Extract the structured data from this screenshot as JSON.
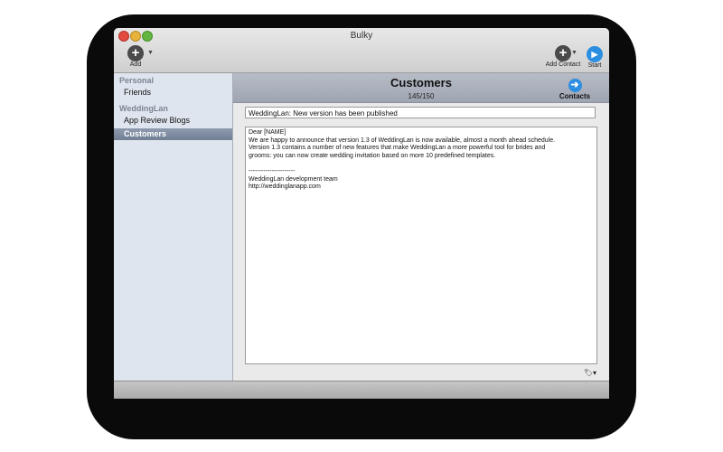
{
  "window": {
    "title": "Bulky"
  },
  "toolbar": {
    "add_icon": "plus-icon",
    "add_label": "Add",
    "add_contact_label": "Add Contact",
    "start_icon": "play-icon",
    "start_label": "Start"
  },
  "sidebar": {
    "groups": [
      {
        "header": "Personal",
        "items": [
          "Friends"
        ]
      },
      {
        "header": "WeddingLan",
        "items": [
          "App Review Blogs",
          "Customers"
        ]
      }
    ],
    "selected": "Customers"
  },
  "main": {
    "title": "Customers",
    "count": "145/150",
    "contacts_label": "Contacts",
    "subject": "WeddingLan: New version has been published",
    "body_lines": [
      "Dear [NAME]",
      "We are happy to announce that version 1.3 of WeddingLan is now available, almost a month ahead schedule.",
      "Version 1.3  contains a number of new features that make WeddingLan a more powerful tool for brides and",
      "grooms: you can now create wedding invitation based on more 10 predefined templates.",
      "",
      "----------------------",
      "WeddingLan development team",
      "http://weddinglanapp.com"
    ]
  },
  "colors": {
    "accent_blue": "#2b8ee0",
    "selection": "#7b889d"
  }
}
